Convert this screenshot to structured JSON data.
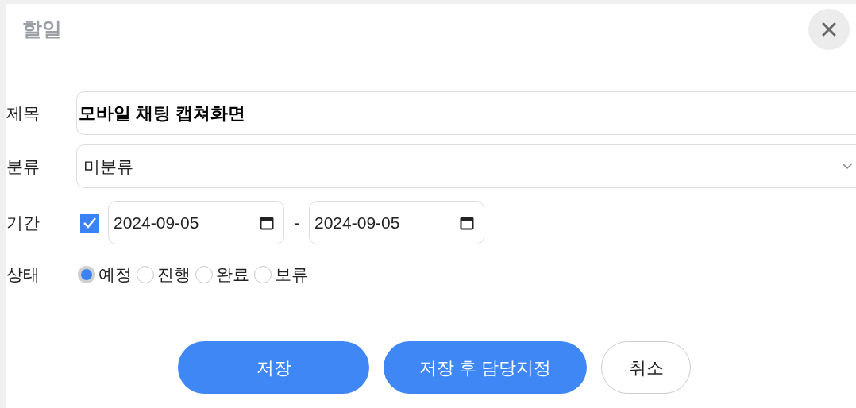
{
  "dialog": {
    "title": "할일"
  },
  "subject": {
    "label": "제목",
    "value": "모바일 채팅 캡쳐화면"
  },
  "category": {
    "label": "분류",
    "value": "미분류"
  },
  "period": {
    "label": "기간",
    "checked": true,
    "start": "2024-09-05",
    "separator": "-",
    "end": "2024-09-05"
  },
  "status": {
    "label": "상태",
    "options": [
      {
        "label": "예정",
        "selected": true
      },
      {
        "label": "진행",
        "selected": false
      },
      {
        "label": "완료",
        "selected": false
      },
      {
        "label": "보류",
        "selected": false
      }
    ]
  },
  "buttons": [
    {
      "label": "저장",
      "kind": "primary"
    },
    {
      "label": "저장 후 담당지정",
      "kind": "primary"
    },
    {
      "label": "취소",
      "kind": "secondary"
    }
  ]
}
